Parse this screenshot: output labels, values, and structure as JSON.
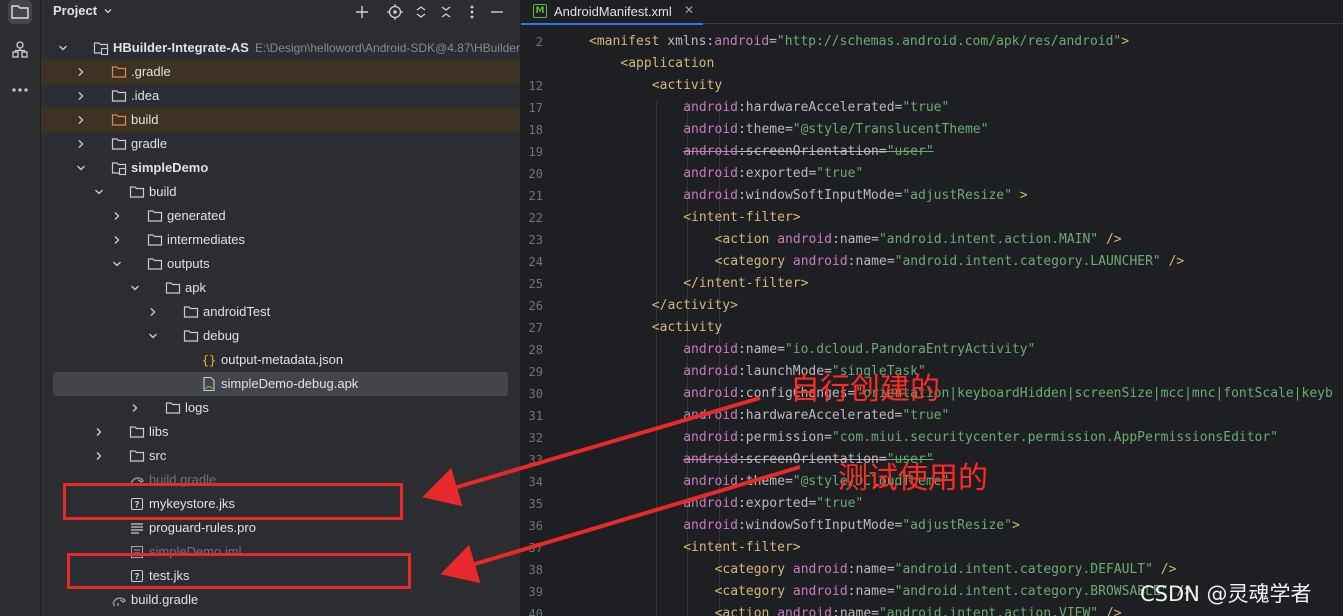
{
  "project_panel": {
    "title": "Project",
    "tree": [
      {
        "label": "HBuilder-Integrate-AS",
        "path": "E:\\Design\\helloword\\Android-SDK@4.87\\HBuilder",
        "depth": 0,
        "expanded": true,
        "icon": "module-folder-icon",
        "bold": true
      },
      {
        "label": ".gradle",
        "depth": 1,
        "expanded": false,
        "icon": "folder-icon",
        "excluded": true
      },
      {
        "label": ".idea",
        "depth": 1,
        "expanded": false,
        "icon": "folder-icon"
      },
      {
        "label": "build",
        "depth": 1,
        "expanded": false,
        "icon": "folder-icon",
        "excluded": true
      },
      {
        "label": "gradle",
        "depth": 1,
        "expanded": false,
        "icon": "folder-icon"
      },
      {
        "label": "simpleDemo",
        "depth": 1,
        "expanded": true,
        "icon": "module-folder-icon",
        "bold": true
      },
      {
        "label": "build",
        "depth": 2,
        "expanded": true,
        "icon": "folder-icon"
      },
      {
        "label": "generated",
        "depth": 3,
        "expanded": false,
        "icon": "folder-icon"
      },
      {
        "label": "intermediates",
        "depth": 3,
        "expanded": false,
        "icon": "folder-icon"
      },
      {
        "label": "outputs",
        "depth": 3,
        "expanded": true,
        "icon": "folder-icon"
      },
      {
        "label": "apk",
        "depth": 4,
        "expanded": true,
        "icon": "folder-icon"
      },
      {
        "label": "androidTest",
        "depth": 5,
        "expanded": false,
        "icon": "folder-icon"
      },
      {
        "label": "debug",
        "depth": 5,
        "expanded": true,
        "icon": "folder-icon"
      },
      {
        "label": "output-metadata.json",
        "depth": 6,
        "icon": "json-file-icon"
      },
      {
        "label": "simpleDemo-debug.apk",
        "depth": 6,
        "icon": "apk-file-icon",
        "selected": true
      },
      {
        "label": "logs",
        "depth": 4,
        "expanded": false,
        "icon": "folder-icon"
      },
      {
        "label": "libs",
        "depth": 2,
        "expanded": false,
        "icon": "folder-icon"
      },
      {
        "label": "src",
        "depth": 2,
        "expanded": false,
        "icon": "folder-icon"
      },
      {
        "label": "build.gradle",
        "depth": 2,
        "icon": "gradle-file-icon",
        "ghost": true
      },
      {
        "label": "mykeystore.jks",
        "depth": 2,
        "icon": "unknown-file-icon"
      },
      {
        "label": "proguard-rules.pro",
        "depth": 2,
        "icon": "text-file-icon"
      },
      {
        "label": "simpleDemo.iml",
        "depth": 2,
        "icon": "iml-file-icon",
        "ghost": true
      },
      {
        "label": "test.jks",
        "depth": 2,
        "icon": "unknown-file-icon"
      },
      {
        "label": "build.gradle",
        "depth": 1,
        "icon": "gradle-file-icon"
      }
    ]
  },
  "editor": {
    "tab_label": "AndroidManifest.xml",
    "lines": [
      {
        "n": "2",
        "indent": 1,
        "parts": [
          [
            "t-tag",
            "<manifest "
          ],
          [
            "t-attr",
            "xmlns:"
          ],
          [
            "t-ns",
            "android"
          ],
          [
            "t-plain",
            "="
          ],
          [
            "t-str",
            "\"http://schemas.android.com/apk/res/android\""
          ],
          [
            "t-tag",
            ">"
          ]
        ]
      },
      {
        "n": "",
        "indent": 2,
        "parts": [
          [
            "t-tag",
            "<application"
          ]
        ]
      },
      {
        "n": "12",
        "indent": 3,
        "parts": [
          [
            "t-tag",
            "<activity"
          ]
        ]
      },
      {
        "n": "17",
        "indent": 4,
        "parts": [
          [
            "t-ns",
            "android"
          ],
          [
            "t-attr",
            ":hardwareAccelerated"
          ],
          [
            "t-plain",
            "="
          ],
          [
            "t-str",
            "\"true\""
          ]
        ]
      },
      {
        "n": "18",
        "indent": 4,
        "parts": [
          [
            "t-ns",
            "android"
          ],
          [
            "t-attr",
            ":theme"
          ],
          [
            "t-plain",
            "="
          ],
          [
            "t-str",
            "\"@style/TranslucentTheme\""
          ]
        ]
      },
      {
        "n": "19",
        "indent": 4,
        "strike": true,
        "parts": [
          [
            "t-ns",
            "android"
          ],
          [
            "t-attr",
            ":screenOrientation"
          ],
          [
            "t-plain",
            "="
          ],
          [
            "t-str",
            "\"user\""
          ]
        ]
      },
      {
        "n": "20",
        "indent": 4,
        "parts": [
          [
            "t-ns",
            "android"
          ],
          [
            "t-attr",
            ":exported"
          ],
          [
            "t-plain",
            "="
          ],
          [
            "t-str",
            "\"true\""
          ]
        ]
      },
      {
        "n": "21",
        "indent": 4,
        "parts": [
          [
            "t-ns",
            "android"
          ],
          [
            "t-attr",
            ":windowSoftInputMode"
          ],
          [
            "t-plain",
            "="
          ],
          [
            "t-str",
            "\"adjustResize\""
          ],
          [
            "t-tag",
            " >"
          ]
        ]
      },
      {
        "n": "22",
        "indent": 4,
        "parts": [
          [
            "t-tag",
            "<intent-filter>"
          ]
        ]
      },
      {
        "n": "23",
        "indent": 5,
        "parts": [
          [
            "t-tag",
            "<action "
          ],
          [
            "t-ns",
            "android"
          ],
          [
            "t-attr",
            ":name"
          ],
          [
            "t-plain",
            "="
          ],
          [
            "t-str",
            "\"android.intent.action.MAIN\""
          ],
          [
            "t-tag",
            " />"
          ]
        ]
      },
      {
        "n": "24",
        "indent": 5,
        "parts": [
          [
            "t-tag",
            "<category "
          ],
          [
            "t-ns",
            "android"
          ],
          [
            "t-attr",
            ":name"
          ],
          [
            "t-plain",
            "="
          ],
          [
            "t-str",
            "\"android.intent.category.LAUNCHER\""
          ],
          [
            "t-tag",
            " />"
          ]
        ]
      },
      {
        "n": "25",
        "indent": 4,
        "parts": [
          [
            "t-tag",
            "</intent-filter>"
          ]
        ]
      },
      {
        "n": "26",
        "indent": 3,
        "parts": [
          [
            "t-tag",
            "</activity>"
          ]
        ]
      },
      {
        "n": "27",
        "indent": 3,
        "parts": [
          [
            "t-tag",
            "<activity"
          ]
        ]
      },
      {
        "n": "28",
        "indent": 4,
        "parts": [
          [
            "t-ns",
            "android"
          ],
          [
            "t-attr",
            ":name"
          ],
          [
            "t-plain",
            "="
          ],
          [
            "t-str",
            "\"io.dcloud.PandoraEntryActivity\""
          ]
        ]
      },
      {
        "n": "29",
        "indent": 4,
        "parts": [
          [
            "t-ns",
            "android"
          ],
          [
            "t-attr",
            ":launchMode"
          ],
          [
            "t-plain",
            "="
          ],
          [
            "t-str",
            "\"singleTask\""
          ]
        ]
      },
      {
        "n": "30",
        "indent": 4,
        "parts": [
          [
            "t-ns",
            "android"
          ],
          [
            "t-attr",
            ":configChanges"
          ],
          [
            "t-plain",
            "="
          ],
          [
            "t-str",
            "\"orientation|keyboardHidden|screenSize|mcc|mnc|fontScale|keyb"
          ]
        ]
      },
      {
        "n": "31",
        "indent": 4,
        "parts": [
          [
            "t-ns",
            "android"
          ],
          [
            "t-attr",
            ":hardwareAccelerated"
          ],
          [
            "t-plain",
            "="
          ],
          [
            "t-str",
            "\"true\""
          ]
        ]
      },
      {
        "n": "32",
        "indent": 4,
        "parts": [
          [
            "t-ns",
            "android"
          ],
          [
            "t-attr",
            ":permission"
          ],
          [
            "t-plain",
            "="
          ],
          [
            "t-str",
            "\"com.miui.securitycenter.permission.AppPermissionsEditor\""
          ]
        ]
      },
      {
        "n": "33",
        "indent": 4,
        "strike": true,
        "parts": [
          [
            "t-ns",
            "android"
          ],
          [
            "t-attr",
            ":screenOrientation"
          ],
          [
            "t-plain",
            "="
          ],
          [
            "t-str",
            "\"user\""
          ]
        ]
      },
      {
        "n": "34",
        "indent": 4,
        "parts": [
          [
            "t-ns",
            "android"
          ],
          [
            "t-attr",
            ":theme"
          ],
          [
            "t-plain",
            "="
          ],
          [
            "t-str",
            "\"@style/DCloudTheme\""
          ]
        ]
      },
      {
        "n": "35",
        "indent": 4,
        "parts": [
          [
            "t-ns",
            "android"
          ],
          [
            "t-attr",
            ":exported"
          ],
          [
            "t-plain",
            "="
          ],
          [
            "t-str",
            "\"true\""
          ]
        ]
      },
      {
        "n": "36",
        "indent": 4,
        "parts": [
          [
            "t-ns",
            "android"
          ],
          [
            "t-attr",
            ":windowSoftInputMode"
          ],
          [
            "t-plain",
            "="
          ],
          [
            "t-str",
            "\"adjustResize\""
          ],
          [
            "t-tag",
            ">"
          ]
        ]
      },
      {
        "n": "37",
        "indent": 4,
        "parts": [
          [
            "t-tag",
            "<intent-filter>"
          ]
        ]
      },
      {
        "n": "38",
        "indent": 5,
        "parts": [
          [
            "t-tag",
            "<category "
          ],
          [
            "t-ns",
            "android"
          ],
          [
            "t-attr",
            ":name"
          ],
          [
            "t-plain",
            "="
          ],
          [
            "t-str",
            "\"android.intent.category.DEFAULT\""
          ],
          [
            "t-tag",
            " />"
          ]
        ]
      },
      {
        "n": "39",
        "indent": 5,
        "parts": [
          [
            "t-tag",
            "<category "
          ],
          [
            "t-ns",
            "android"
          ],
          [
            "t-attr",
            ":name"
          ],
          [
            "t-plain",
            "="
          ],
          [
            "t-str",
            "\"android.intent.category.BROWSABLE\""
          ],
          [
            "t-tag",
            " />"
          ]
        ]
      },
      {
        "n": "40",
        "indent": 5,
        "parts": [
          [
            "t-tag",
            "<action "
          ],
          [
            "t-ns",
            "android"
          ],
          [
            "t-attr",
            ":name"
          ],
          [
            "t-plain",
            "="
          ],
          [
            "t-str",
            "\"android.intent.action.VIEW\""
          ],
          [
            "t-tag",
            " />"
          ]
        ]
      }
    ]
  },
  "annotations": {
    "label_1": "自行创建的",
    "label_2": "测试使用的",
    "color": "#e8292b"
  },
  "watermark": "CSDN @灵魂学者",
  "colors": {
    "panel_bg": "#2b2d30",
    "editor_bg": "#1e1f22",
    "excluded_row_bg": "#3d3223",
    "folder_icon": "#c9ccd1",
    "excluded_folder_icon": "#e08855",
    "tab_accent": "#3574f0"
  }
}
